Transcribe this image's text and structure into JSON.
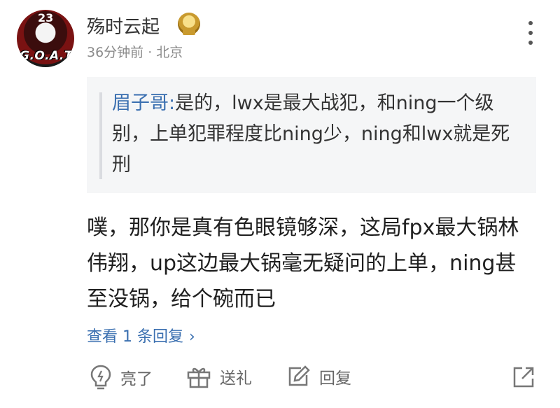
{
  "user": {
    "name": "殇时云起",
    "avatar_number": "23",
    "avatar_text": "G.O.A.T",
    "meta": "36分钟前 · 北京"
  },
  "quote": {
    "author": "眉子哥:",
    "text": "是的，lwx是最大战犯，和ning一个级别，上单犯罪程度比ning少，ning和lwx就是死刑"
  },
  "comment": {
    "text": "噗，那你是真有色眼镜够深，这局fpx最大锅林伟翔，up这边最大锅毫无疑问的上单，ning甚至没锅，给个碗而已"
  },
  "replies": {
    "label": "查看 1 条回复"
  },
  "actions": {
    "like": "亮了",
    "gift": "送礼",
    "reply": "回复"
  },
  "icons": [
    "more-icon",
    "lightbulb-icon",
    "gift-icon",
    "edit-icon",
    "share-icon",
    "badge-icon"
  ],
  "colors": {
    "link": "#3a6fb0",
    "quote_bg": "#f5f6f7",
    "meta": "#8a8a8a"
  }
}
